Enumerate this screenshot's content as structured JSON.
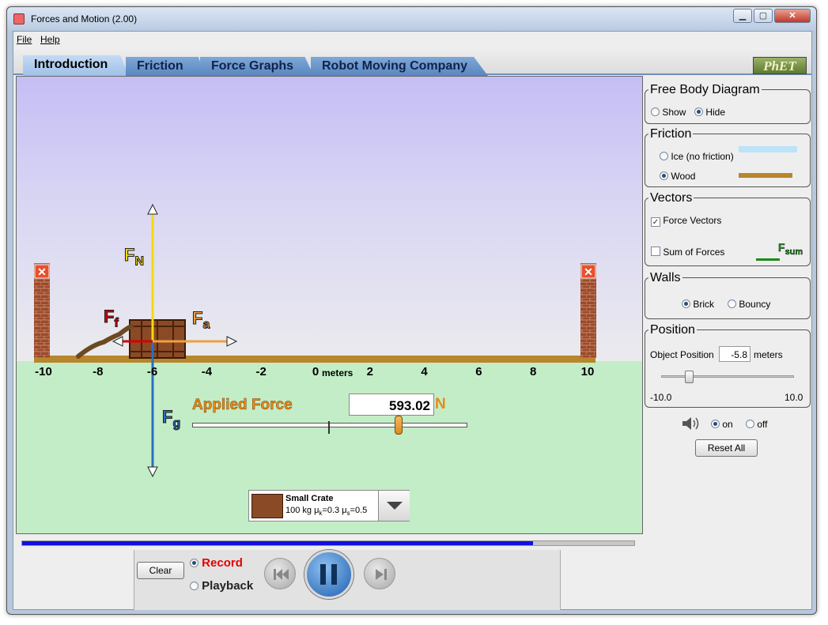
{
  "window": {
    "title": "Forces and Motion (2.00)",
    "minimize": "▁",
    "maximize": "▢",
    "close": "✕"
  },
  "menu": {
    "file": "File",
    "help": "Help"
  },
  "tabs": [
    "Introduction",
    "Friction",
    "Force Graphs",
    "Robot Moving Company"
  ],
  "logo": "PhET",
  "sim": {
    "axis_ticks": [
      "-10",
      "-8",
      "-6",
      "-4",
      "-2",
      "0",
      "2",
      "4",
      "6",
      "8",
      "10"
    ],
    "axis_unit": "meters",
    "vectors": {
      "normal": "F",
      "normal_sub": "N",
      "friction": "F",
      "friction_sub": "f",
      "applied": "F",
      "applied_sub": "a",
      "gravity": "F",
      "gravity_sub": "g"
    },
    "applied_force_label": "Applied Force",
    "applied_force_value": "593.02",
    "applied_force_unit": "N",
    "applied_force_slider_fraction": 0.75,
    "object": {
      "name": "Small Crate",
      "details_mass": "100 kg μ",
      "details_k": "k",
      "details_mu_k": "=0.3 μ",
      "details_s": "s",
      "details_mu_s": "=0.5"
    },
    "wall_close": "✕"
  },
  "panels": {
    "fbd": {
      "title": "Free Body Diagram",
      "show": "Show",
      "hide": "Hide",
      "selected": "hide"
    },
    "friction": {
      "title": "Friction",
      "ice": "Ice (no friction)",
      "wood": "Wood",
      "selected": "wood",
      "ice_color": "#bde3f8",
      "wood_color": "#b8862b"
    },
    "vectors": {
      "title": "Vectors",
      "force_vectors": "Force Vectors",
      "force_vectors_checked": true,
      "sum_of_forces": "Sum of Forces",
      "sum_of_forces_checked": false,
      "fsum_f": "F",
      "fsum_sub": "sum"
    },
    "walls": {
      "title": "Walls",
      "brick": "Brick",
      "bouncy": "Bouncy",
      "selected": "brick"
    },
    "position": {
      "title": "Position",
      "label": "Object Position",
      "value": "-5.8",
      "unit": "meters",
      "min": "-10.0",
      "max": "10.0",
      "fraction": 0.21
    }
  },
  "sound": {
    "on": "on",
    "off": "off",
    "selected": "on"
  },
  "reset_all": "Reset All",
  "playback": {
    "clear": "Clear",
    "record": "Record",
    "playback": "Playback",
    "mode": "record",
    "progress_fraction": 0.835
  },
  "colors": {
    "normal": "#f5d90c",
    "friction": "#d40000",
    "applied": "#f0a040",
    "gravity": "#2a6fc0",
    "applied_text": "#e88a1a",
    "ground": "#b8862b"
  }
}
